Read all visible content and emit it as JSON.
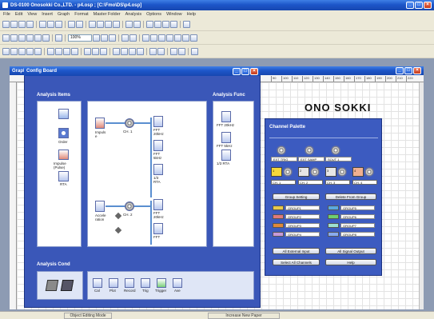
{
  "app": {
    "title": "DS-0100 Onosokki Co.,LTD. - p4.osp ; [C:\\Fmo\\DS\\p4.osp]"
  },
  "menu": [
    "File",
    "Edit",
    "View",
    "Insert",
    "Graph",
    "Format",
    "Master Folder",
    "Analysis",
    "Options",
    "Window",
    "Help"
  ],
  "toolbar": {
    "zoom_value": "100%"
  },
  "document": {
    "title": "Graph",
    "brand": "ONO SOKKI",
    "ruler_ticks": [
      "90",
      "100",
      "110",
      "120",
      "130",
      "140",
      "150",
      "160",
      "170",
      "180",
      "190",
      "200",
      "210",
      "220",
      "230",
      "240"
    ]
  },
  "config_board": {
    "title": "Config Board",
    "analysis_items_title": "Analysis Items",
    "analysis_func_title": "Analysis Func",
    "analysis_cond_title": "Analysis Cond",
    "items": [
      "",
      "Order",
      "Impulse (Pulse)",
      "RTA"
    ],
    "flow": {
      "impulse": "Impuls e",
      "ch1": "CH. 1",
      "accel": "Accele ration",
      "ch2": "CH. 2",
      "fft1": "FFT 20kHz",
      "fft2": "FFT 5kHz",
      "fft3": "1/3 RTA",
      "fft4": "FFT 20kHz",
      "fft5": "FFT"
    },
    "funcs": [
      "FFT 20kHz",
      "FFT 5kHz",
      "1/3 RTA"
    ],
    "cond_icons": [
      "Cal",
      "Plot",
      "Record",
      "Trig",
      "Trigger",
      "Ave"
    ]
  },
  "channel_palette": {
    "title": "Channel Palette",
    "inputs": [
      "EXT TRIG",
      "EXT SAMP",
      "SOUT 1"
    ],
    "channels": [
      "CH. 1",
      "CH. 2",
      "CH. 3",
      "CH. 4"
    ],
    "channel_numbers": [
      "1",
      "2",
      "3",
      "4"
    ],
    "group_setting": "Group Setting",
    "delete_from_group": "Delete From Group",
    "groups_left": [
      "GROUP1",
      "GROUP2",
      "GROUP3",
      "GROUP4"
    ],
    "groups_right": [
      "GROUP5",
      "GROUP6",
      "GROUP7",
      "GROUP8"
    ],
    "all_external_input": "All External Input",
    "all_signal_output": "All Signal Output",
    "select_all_channels": "Select All Channels",
    "help": "Help"
  },
  "colors": {
    "group_left": [
      "#e9c94a",
      "#e07a7a",
      "#e0893a",
      "#c79ad8"
    ],
    "group_right": [
      "#5aa8e0",
      "#6fcf6f",
      "#9ee0d0",
      "#88aaee"
    ],
    "channels": [
      "#f5d83a",
      "#e6e6e6",
      "#e6e6e6",
      "#f0b090"
    ]
  },
  "status": {
    "mode": "Object Editing Mode",
    "action": "Increase New Paper"
  }
}
